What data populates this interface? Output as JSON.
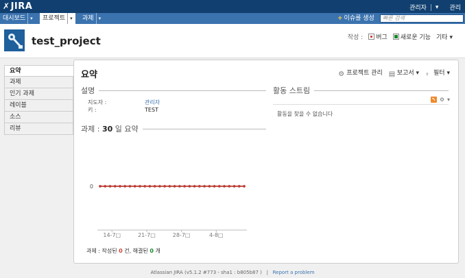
{
  "app": {
    "logo_text": "JIRA"
  },
  "topbar": {
    "user_label": "관리자",
    "admin_label": "관리"
  },
  "nav": {
    "items": [
      {
        "label": "대시보드"
      },
      {
        "label": "프로젝트"
      },
      {
        "label": "과제"
      }
    ],
    "create_issue_label": "이슈를 생성",
    "quick_search_placeholder": "빠른 검색"
  },
  "project": {
    "name": "test_project",
    "create_label": "작성 :",
    "bug_label": "버그",
    "feature_label": "새로운 기능",
    "more_label": "기타"
  },
  "sidebar": {
    "items": [
      {
        "label": "요약"
      },
      {
        "label": "과제"
      },
      {
        "label": "인기 과제"
      },
      {
        "label": "레이블"
      },
      {
        "label": "소스"
      },
      {
        "label": "리뷰"
      }
    ]
  },
  "panel": {
    "title": "요약",
    "manage_label": "프로젝트 관리",
    "reports_label": "보고서",
    "filter_label": "필터"
  },
  "description": {
    "heading": "설명",
    "lead_key": "지도자 :",
    "lead_value": "관리자",
    "key_key": "키 :",
    "key_value": "TEST"
  },
  "activity": {
    "heading": "활동 스트림",
    "empty_message": "활동을 찾을 수 없습니다"
  },
  "chart_section": {
    "heading_prefix": "과제 : ",
    "heading_days": "30",
    "heading_suffix": " 일 요약",
    "footer_prefix": "과제 : 작성된 ",
    "created_count": "0",
    "footer_middle": " 건, 해결된 ",
    "resolved_count": "0",
    "footer_suffix": " 개"
  },
  "chart_data": {
    "type": "line",
    "x": [
      1,
      2,
      3,
      4,
      5,
      6,
      7,
      8,
      9,
      10,
      11,
      12,
      13,
      14,
      15,
      16,
      17,
      18,
      19,
      20,
      21,
      22,
      23,
      24,
      25,
      26,
      27,
      28,
      29,
      30
    ],
    "x_tick_labels": [
      "14-7□",
      "21-7□",
      "28-7□",
      "4-8□"
    ],
    "series": [
      {
        "values": [
          0,
          0,
          0,
          0,
          0,
          0,
          0,
          0,
          0,
          0,
          0,
          0,
          0,
          0,
          0,
          0,
          0,
          0,
          0,
          0,
          0,
          0,
          0,
          0,
          0,
          0,
          0,
          0,
          0,
          0
        ],
        "color": "#cc3333"
      },
      {
        "values": [
          0,
          0,
          0,
          0,
          0,
          0,
          0,
          0,
          0,
          0,
          0,
          0,
          0,
          0,
          0,
          0,
          0,
          0,
          0,
          0,
          0,
          0,
          0,
          0,
          0,
          0,
          0,
          0,
          0,
          0
        ],
        "color": "#14892c"
      }
    ],
    "y_tick_labels": [
      "0"
    ]
  },
  "footer": {
    "version_text": "Atlassian JIRA (v5.1.2 #773 - sha1 : b805b87 )",
    "separator": "|",
    "report_link": "Report a problem"
  },
  "colors": {
    "topbar": "#114070",
    "navbar": "#3b73af",
    "link": "#3b73af",
    "created": "#d04437",
    "resolved": "#14892c"
  }
}
